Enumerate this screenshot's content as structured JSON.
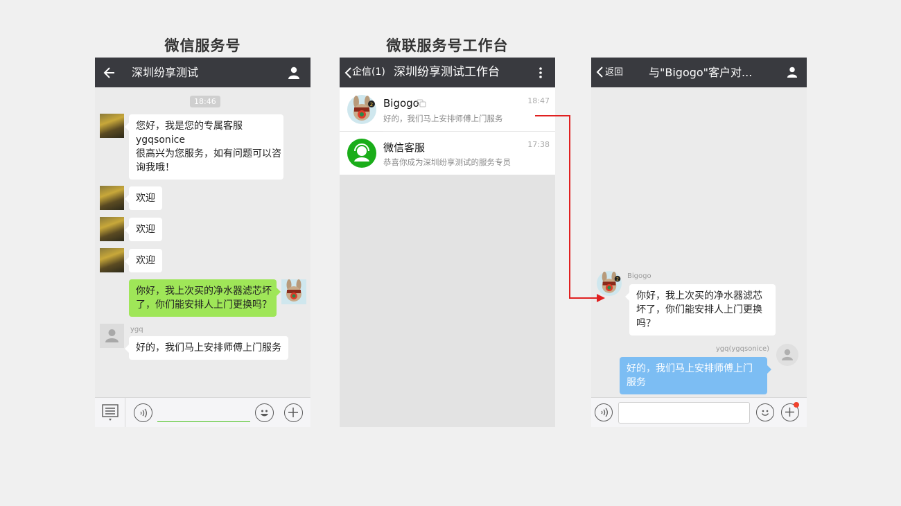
{
  "captions": {
    "left": "微信服务号",
    "middle": "微联服务号工作台"
  },
  "phone1": {
    "header_title": "深圳纷享测试",
    "time_divider": "18:46",
    "messages": [
      {
        "lines": [
          "您好，我是您的专属客服",
          "ygqsonice",
          "很高兴为您服务，如有问题可以咨",
          "询我哦！"
        ]
      },
      {
        "lines": [
          "欢迎"
        ]
      },
      {
        "lines": [
          "欢迎"
        ]
      },
      {
        "lines": [
          "欢迎"
        ]
      },
      {
        "lines": [
          "你好，我上次买的净水器滤芯坏",
          "了，你们能安排人上门更换吗？"
        ]
      },
      {
        "sender": "ygq",
        "lines": [
          "好的，我们马上安排师傅上门服务"
        ]
      }
    ]
  },
  "phone2": {
    "back_label": "企信(1)",
    "header_title": "深圳纷享测试工作台",
    "conversations": [
      {
        "name": "Bigogo",
        "badge": "2",
        "preview": "好的，我们马上安排师傅上门服务",
        "time": "18:47"
      },
      {
        "name": "微信客服",
        "preview": "恭喜你成为深圳纷享测试的服务专员",
        "time": "17:38"
      }
    ]
  },
  "phone3": {
    "back_label": "返回",
    "header_title": "与\"Bigogo\"客户对...",
    "incoming": {
      "sender": "Bigogo",
      "badge": "2",
      "lines": [
        "你好，我上次买的净水器滤芯",
        "坏了，你们能安排人上门更换",
        "吗？"
      ]
    },
    "outgoing": {
      "sender": "ygq(ygqsonice)",
      "lines": [
        "好的，我们马上安排师傅上门",
        "服务"
      ]
    }
  },
  "colors": {
    "topbar": "#393a3f",
    "green_bubble": "#9fe658",
    "blue_bubble": "#7cbdf3",
    "arrow": "#e02020",
    "service_green": "#1aad19",
    "notify_dot": "#f0412b"
  }
}
